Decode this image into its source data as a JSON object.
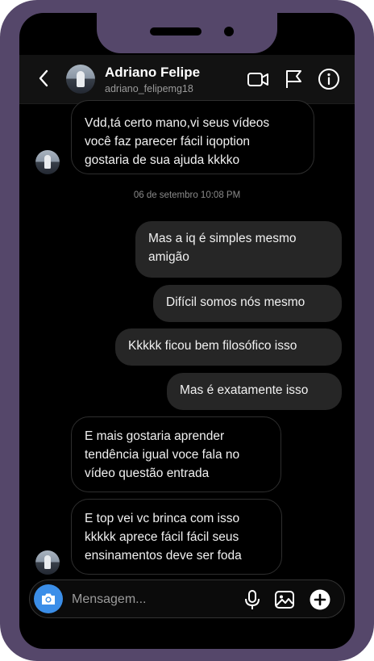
{
  "header": {
    "name": "Adriano Felipe",
    "username": "adriano_felipemg18"
  },
  "messages": [
    {
      "direction": "received",
      "lines": [
        "Vdd,tá certo mano,vi seus vídeos",
        "você faz parecer fácil iqoption",
        "gostaria de sua ajuda kkkko"
      ]
    },
    {
      "direction": "sent",
      "lines": [
        "Mas a iq é simples mesmo",
        "amigão"
      ]
    },
    {
      "direction": "sent",
      "lines": [
        "Difícil somos nós mesmo"
      ]
    },
    {
      "direction": "sent",
      "lines": [
        "Kkkkk ficou bem filosófico isso"
      ]
    },
    {
      "direction": "sent",
      "lines": [
        "Mas é exatamente isso"
      ]
    },
    {
      "direction": "received",
      "lines": [
        "E mais gostaria aprender",
        "tendência igual voce fala no",
        "vídeo questão entrada"
      ]
    },
    {
      "direction": "received",
      "lines": [
        "E top vei vc brinca com isso",
        "kkkkk aprece fácil fácil seus",
        "ensinamentos deve ser foda"
      ]
    }
  ],
  "timestamp": "06 de setembro 10:08 PM",
  "composer": {
    "placeholder": "Mensagem..."
  },
  "icons": {
    "back": "chevron-left-icon",
    "video_call": "video-camera-icon",
    "report": "flag-icon",
    "info": "info-icon",
    "camera": "camera-icon",
    "mic": "microphone-icon",
    "gallery": "image-icon",
    "more": "plus-circle-icon"
  },
  "colors": {
    "frame": "#55476a",
    "accent": "#3b8ee8",
    "bubble_sent": "#262626",
    "background": "#000000"
  }
}
